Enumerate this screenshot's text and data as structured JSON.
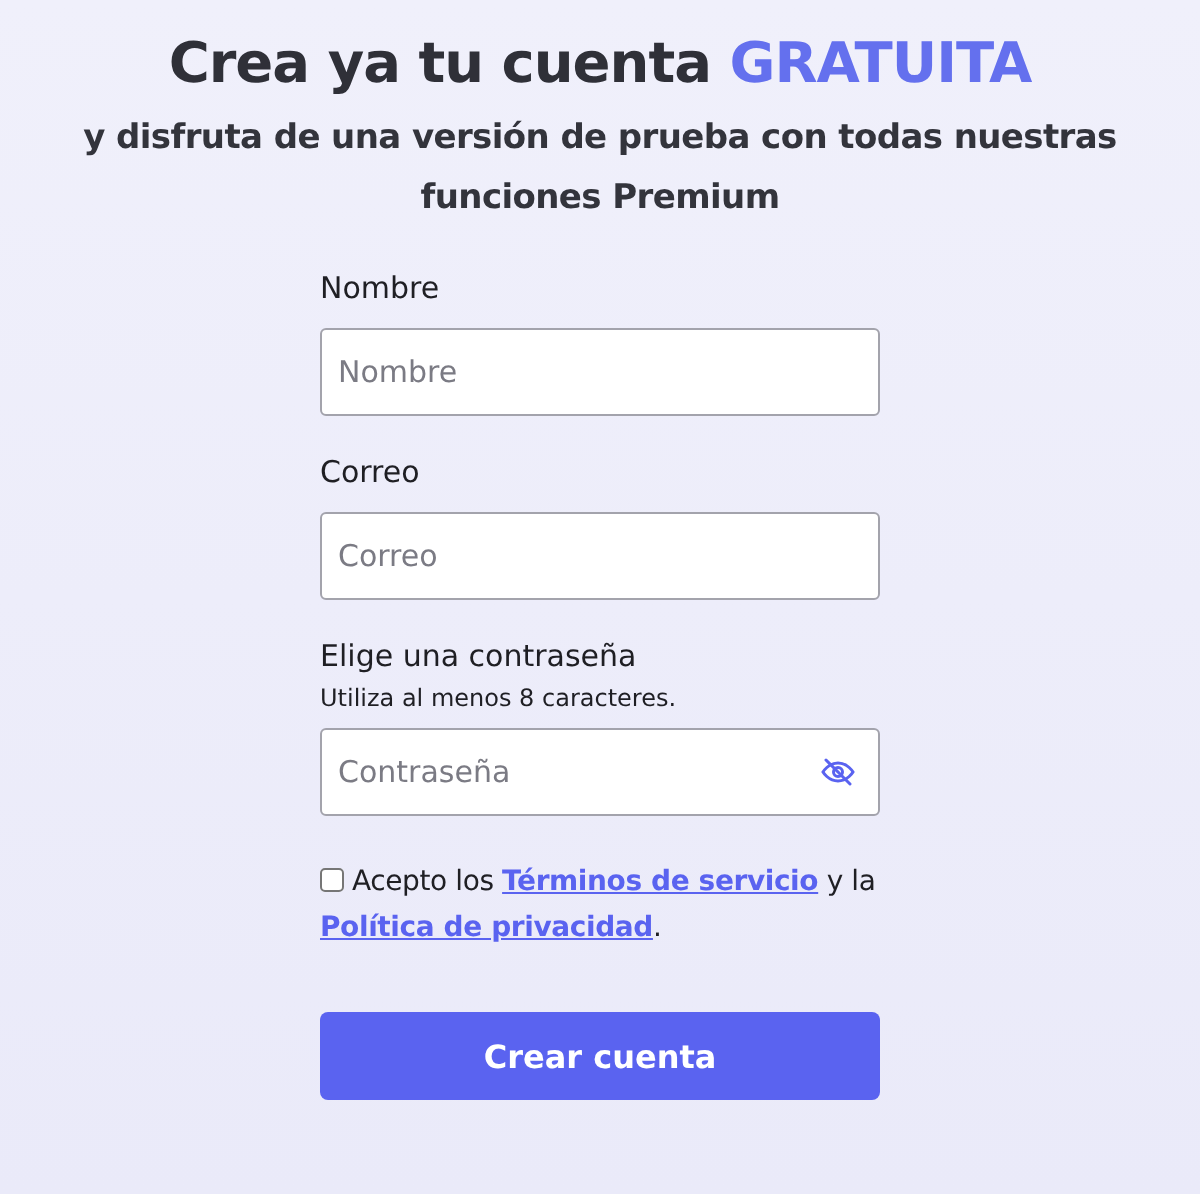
{
  "heading": {
    "text": "Crea ya tu cuenta",
    "highlight": "GRATUITA"
  },
  "subheading": "y disfruta de una versión de prueba con todas nuestras funciones Premium",
  "fields": [
    {
      "label": "Nombre",
      "placeholder": "Nombre",
      "kind": "text"
    },
    {
      "label": "Correo",
      "placeholder": "Correo",
      "kind": "text"
    },
    {
      "label": "Elige una contraseña",
      "hint": "Utiliza al menos 8 caracteres.",
      "placeholder": "Contraseña",
      "kind": "password"
    }
  ],
  "consent": {
    "checked": false,
    "parts": [
      {
        "kind": "text",
        "text": "Acepto los "
      },
      {
        "kind": "link",
        "text": "Términos de servicio"
      },
      {
        "kind": "text",
        "text": " y la "
      },
      {
        "kind": "link",
        "text": "Política de privacidad"
      },
      {
        "kind": "text",
        "text": "."
      }
    ]
  },
  "submit": "Crear cuenta"
}
